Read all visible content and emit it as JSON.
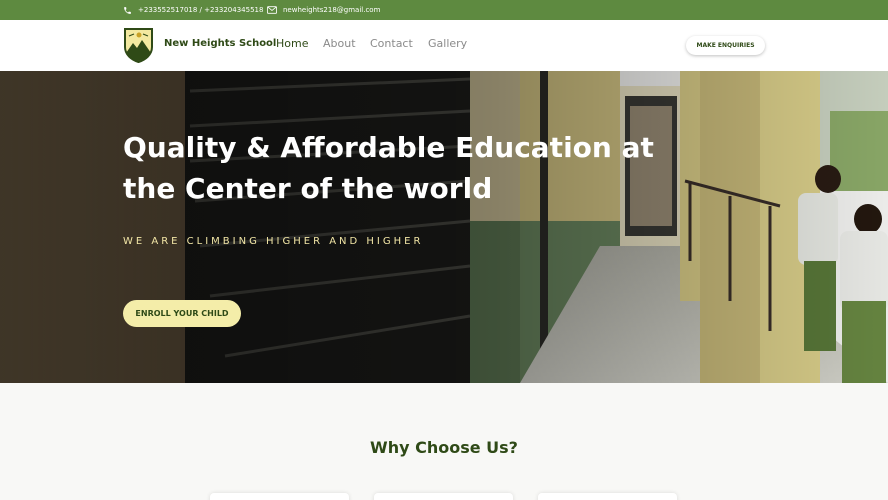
{
  "topbar": {
    "phone": "+233552517018 / +233204345518",
    "email": "newheights218@gmail.com",
    "phone_icon": "phone-icon",
    "email_icon": "mail-icon"
  },
  "header": {
    "school_name": "New Heights School",
    "nav": [
      "Home",
      "About",
      "Contact",
      "Gallery"
    ],
    "active_nav": "Home",
    "enquiries_label": "MAKE ENQUIRIES"
  },
  "hero": {
    "title": "Quality & Affordable Education at the Center of the world",
    "subtitle": "WE ARE CLIMBING HIGHER AND HIGHER",
    "enroll_label": "ENROLL YOUR CHILD"
  },
  "section": {
    "title": "Why Choose Us?"
  },
  "colors": {
    "brand_green": "#5e8a40",
    "dark_green": "#2f4a17",
    "accent_cream": "#f4eda9"
  }
}
